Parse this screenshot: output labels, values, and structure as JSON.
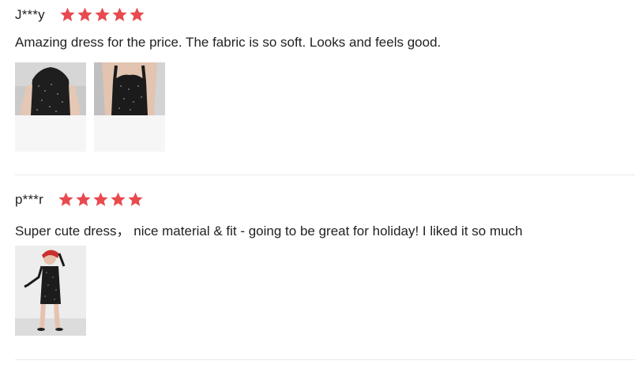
{
  "reviews": [
    {
      "author": "J***y",
      "rating": 5,
      "text": "Amazing dress for the price. The fabric is so soft. Looks and feels good.",
      "photos": [
        "review-photo",
        "review-photo"
      ]
    },
    {
      "author": "p***r",
      "rating": 5,
      "text": "Super cute dress， nice material & fit - going to be great for holiday! I liked it so much",
      "photos": [
        "review-photo"
      ]
    }
  ],
  "colors": {
    "star": "#e84a4f",
    "divider": "#e9e9e9",
    "text": "#222222"
  },
  "icons": [
    "star-icon"
  ]
}
